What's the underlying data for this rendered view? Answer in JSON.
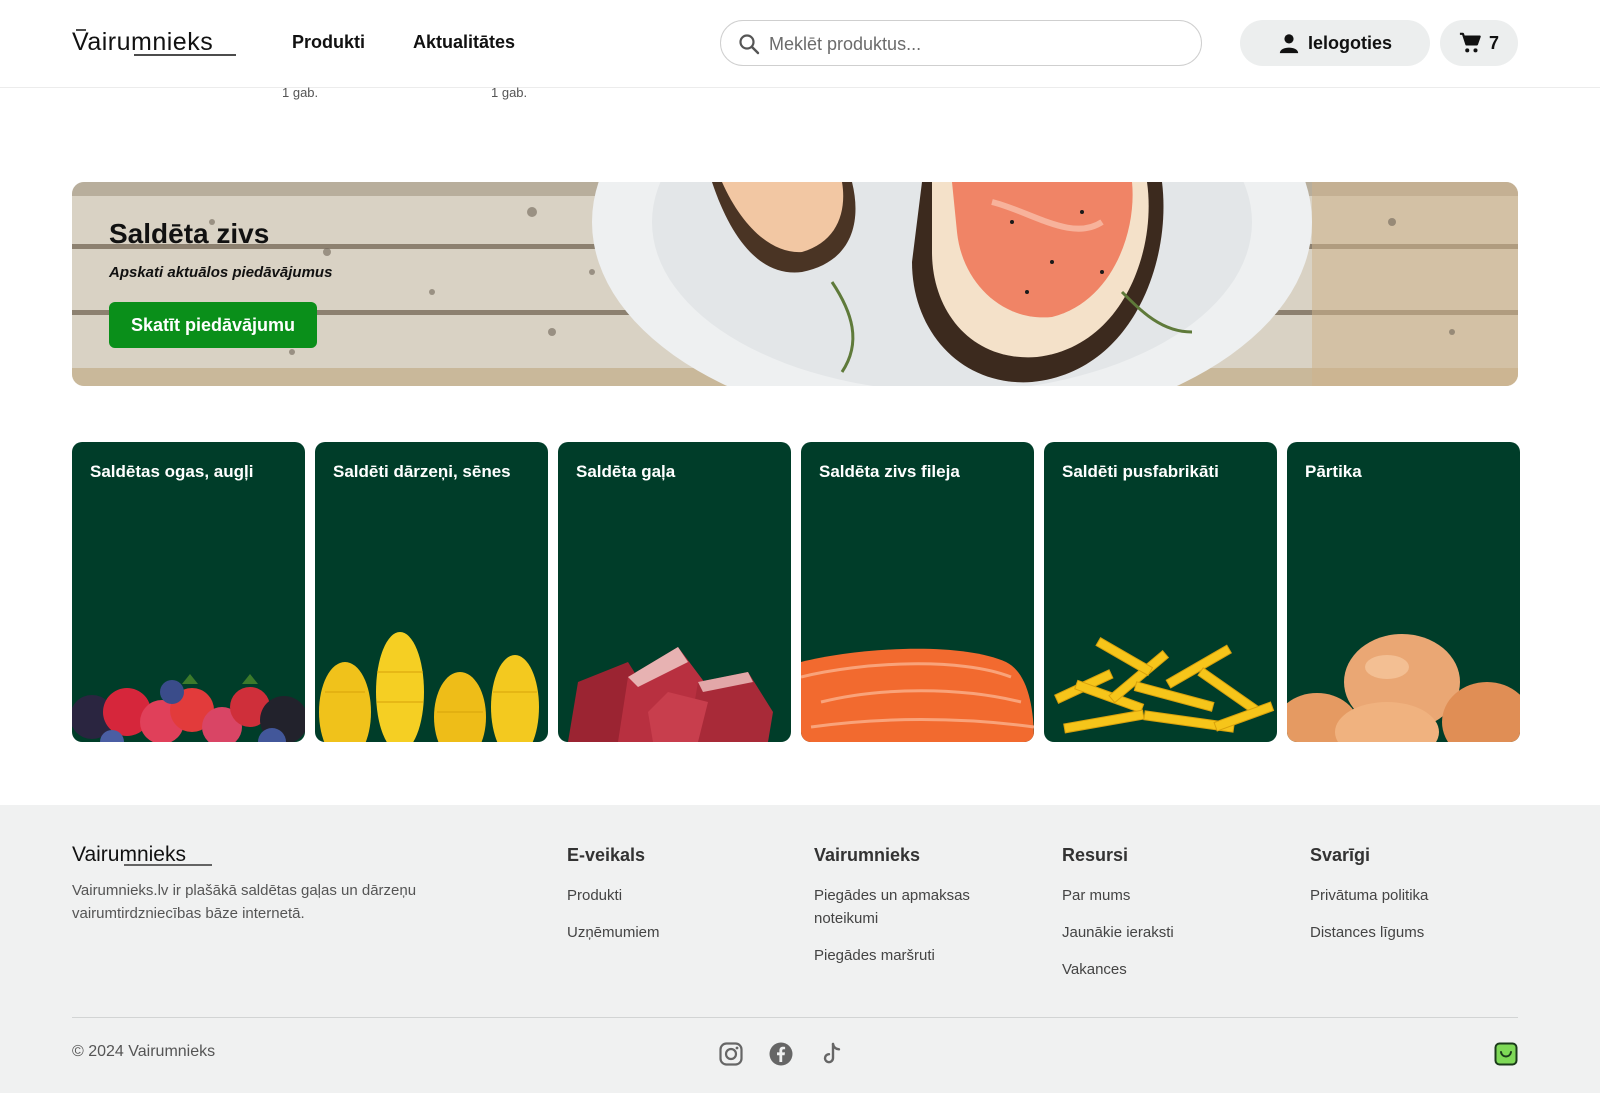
{
  "header": {
    "logo_text": "Vairumnieks",
    "nav": [
      {
        "label": "Produkti"
      },
      {
        "label": "Aktualitātes"
      }
    ],
    "search_placeholder": "Meklēt produktus...",
    "login_label": "Ielogoties",
    "cart_count": "7"
  },
  "remnant": {
    "qty1": "1 gab.",
    "qty2": "1 gab."
  },
  "banner": {
    "title": "Saldēta zivs",
    "subtitle": "Apskati aktuālos piedāvājumus",
    "button_label": "Skatīt piedāvājumu",
    "button_color": "#0a8f1a"
  },
  "categories": [
    {
      "label": "Saldētas ogas, augļi",
      "icon": "berries"
    },
    {
      "label": "Saldēti dārzeņi, sēnes",
      "icon": "corn"
    },
    {
      "label": "Saldēta gaļa",
      "icon": "meat"
    },
    {
      "label": "Saldēta zivs fileja",
      "icon": "salmon"
    },
    {
      "label": "Saldēti pusfabrikāti",
      "icon": "fries"
    },
    {
      "label": "Pārtika",
      "icon": "eggs"
    }
  ],
  "category_bg_color": "#003d29",
  "footer": {
    "logo_text": "Vairumnieks",
    "description": "Vairumnieks.lv ir plašākā saldētas gaļas un dārzeņu vairumtirdzniecības bāze internetā.",
    "columns": [
      {
        "title": "E-veikals",
        "links": [
          "Produkti",
          "Uzņēmumiem"
        ]
      },
      {
        "title": "Vairumnieks",
        "links": [
          "Piegādes un apmaksas noteikumi",
          "Piegādes maršruti"
        ]
      },
      {
        "title": "Resursi",
        "links": [
          "Par mums",
          "Jaunākie ieraksti",
          "Vakances"
        ]
      },
      {
        "title": "Svarīgi",
        "links": [
          "Privātuma politika",
          "Distances līgums"
        ]
      }
    ],
    "copyright": "© 2024 Vairumnieks",
    "social": [
      "instagram-icon",
      "facebook-icon",
      "tiktok-icon"
    ]
  }
}
